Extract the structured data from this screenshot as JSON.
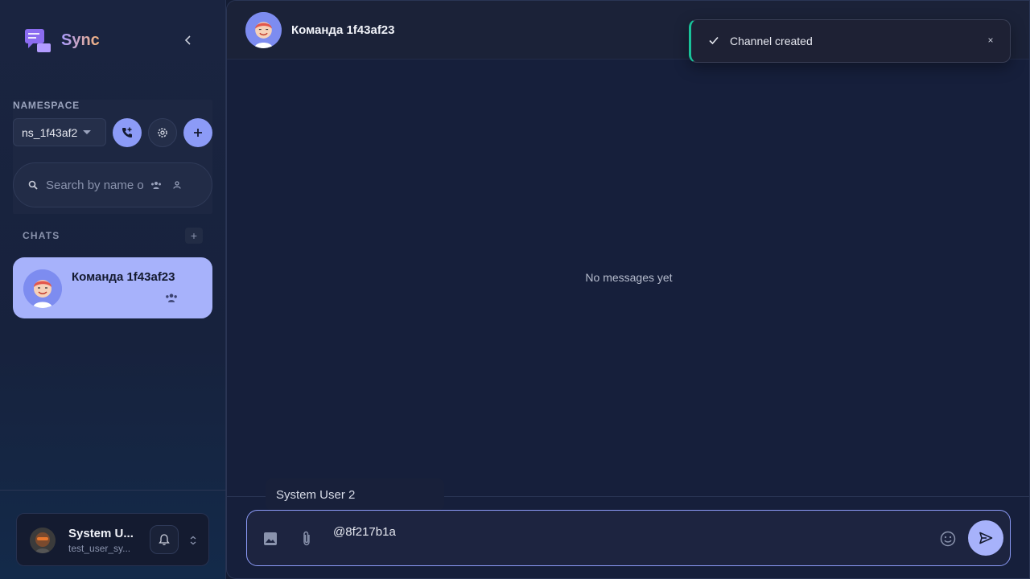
{
  "brand": {
    "name": "Sync"
  },
  "sidebar": {
    "namespace_label": "NAMESPACE",
    "namespace_value": "ns_1f43af2",
    "search_placeholder": "Search by name o",
    "chats_label": "CHATS",
    "chats_add_label": "+",
    "chats": [
      {
        "title": "Команда 1f43af23",
        "type": "group"
      }
    ]
  },
  "user": {
    "name": "System U...",
    "handle": "test_user_sy..."
  },
  "chat": {
    "title": "Команда 1f43af23",
    "empty_text": "No messages yet"
  },
  "mention": {
    "suggestion": "System User 2"
  },
  "composer": {
    "value": "@8f217b1a"
  },
  "toast": {
    "message": "Channel created",
    "close_label": "×"
  },
  "colors": {
    "accent": "#8c9bf7",
    "chat_selected": "#a7b2fb",
    "success": "#19c39a",
    "background": "#161f3b"
  }
}
